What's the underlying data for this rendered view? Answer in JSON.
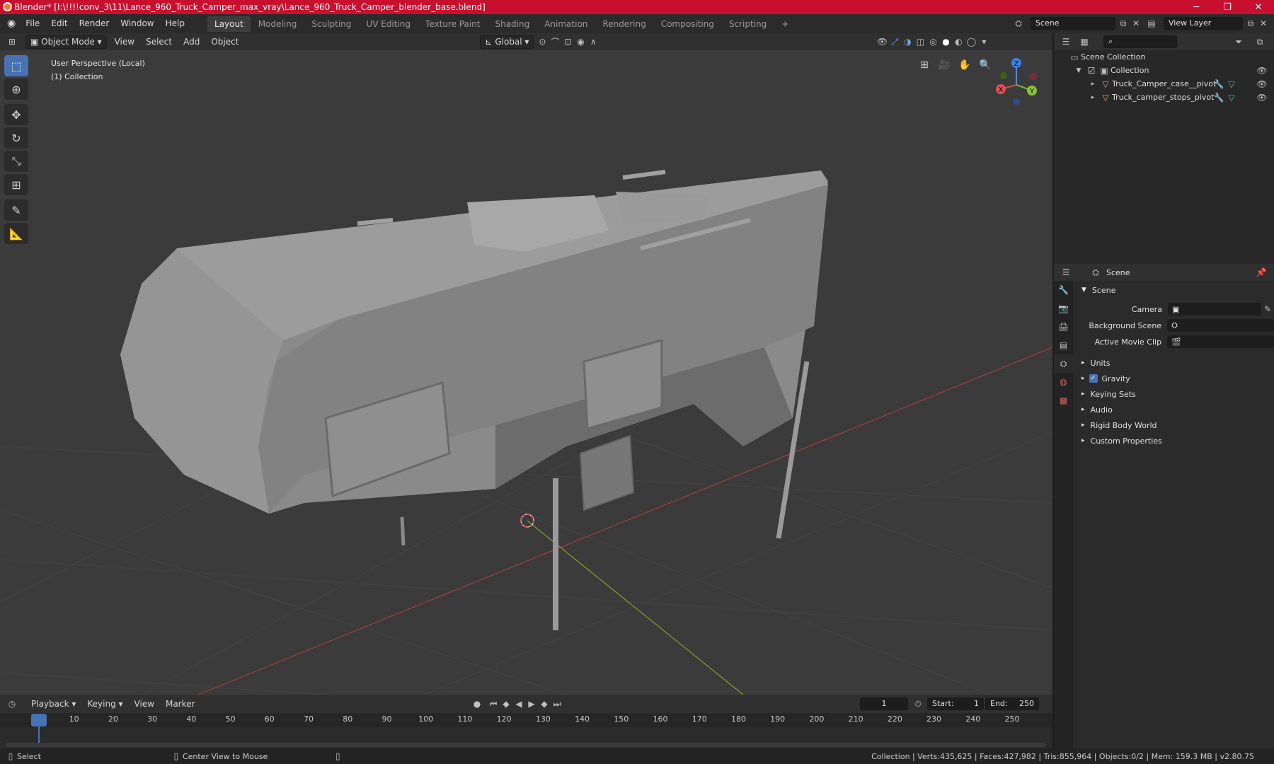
{
  "window": {
    "title": "Blender* [I:\\!!!!conv_3\\11\\Lance_960_Truck_Camper_max_vray\\Lance_960_Truck_Camper_blender_base.blend]",
    "minimize": "─",
    "maximize": "❐",
    "close": "✕"
  },
  "menu": [
    "File",
    "Edit",
    "Render",
    "Window",
    "Help"
  ],
  "workspaces": [
    "Layout",
    "Modeling",
    "Sculpting",
    "UV Editing",
    "Texture Paint",
    "Shading",
    "Animation",
    "Rendering",
    "Compositing",
    "Scripting"
  ],
  "workspace_add": "+",
  "scene_field": "Scene",
  "view_layer_field": "View Layer",
  "header3d": {
    "mode": "Object Mode",
    "menus": [
      "View",
      "Select",
      "Add",
      "Object"
    ],
    "orientation": "Global"
  },
  "viewport": {
    "perspective": "User Perspective (Local)",
    "collection": "(1) Collection",
    "gizmo": {
      "x": "X",
      "y": "Y",
      "z": "Z"
    }
  },
  "outliner": {
    "root": "Scene Collection",
    "collection": "Collection",
    "objects": [
      "Truck_Camper_case__pivot",
      "Truck_camper_stops_pivot"
    ],
    "search_placeholder": ""
  },
  "properties": {
    "header": "Scene",
    "section": "Scene",
    "fields": [
      {
        "label": "Camera",
        "value": ""
      },
      {
        "label": "Background Scene",
        "value": ""
      },
      {
        "label": "Active Movie Clip",
        "value": ""
      }
    ],
    "panels": [
      "Units",
      "Gravity",
      "Keying Sets",
      "Audio",
      "Rigid Body World",
      "Custom Properties"
    ],
    "gravity_checked": true
  },
  "timeline": {
    "menus": [
      "Playback",
      "Keying",
      "View",
      "Marker"
    ],
    "current_frame": "1",
    "start_label": "Start:",
    "start": "1",
    "end_label": "End:",
    "end": "250",
    "ticks": [
      "1",
      "10",
      "20",
      "30",
      "40",
      "50",
      "60",
      "70",
      "80",
      "90",
      "100",
      "110",
      "120",
      "130",
      "140",
      "150",
      "160",
      "170",
      "180",
      "190",
      "200",
      "210",
      "220",
      "230",
      "240",
      "250"
    ]
  },
  "status": {
    "select": "Select",
    "center": "Center View to Mouse",
    "stats": "Collection | Verts:435,625 | Faces:427,982 | Tris:855,964 | Objects:0/2 | Mem: 159.3 MB | v2.80.75"
  }
}
